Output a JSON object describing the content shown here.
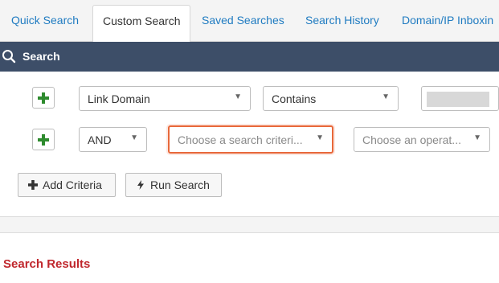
{
  "tabs": [
    {
      "label": "Quick Search",
      "active": false
    },
    {
      "label": "Custom Search",
      "active": true
    },
    {
      "label": "Saved Searches",
      "active": false
    },
    {
      "label": "Search History",
      "active": false
    },
    {
      "label": "Domain/IP Inboxin",
      "active": false
    }
  ],
  "search_bar": {
    "title": "Search",
    "icon": "search-icon"
  },
  "criteria": [
    {
      "field": "Link Domain",
      "operator": "Contains",
      "value_redacted": true
    },
    {
      "conjunction": "AND",
      "field_placeholder": "Choose a search criteri...",
      "operator_placeholder": "Choose an operat..."
    }
  ],
  "buttons": {
    "add_criteria": "Add Criteria",
    "run_search": "Run Search"
  },
  "results": {
    "title": "Search Results"
  },
  "colors": {
    "header_bg": "#3d4e68",
    "tab_link": "#1f7bc1",
    "plus_green": "#2e8b2e",
    "focus_border": "#e8683a",
    "results_title": "#c0272d"
  }
}
